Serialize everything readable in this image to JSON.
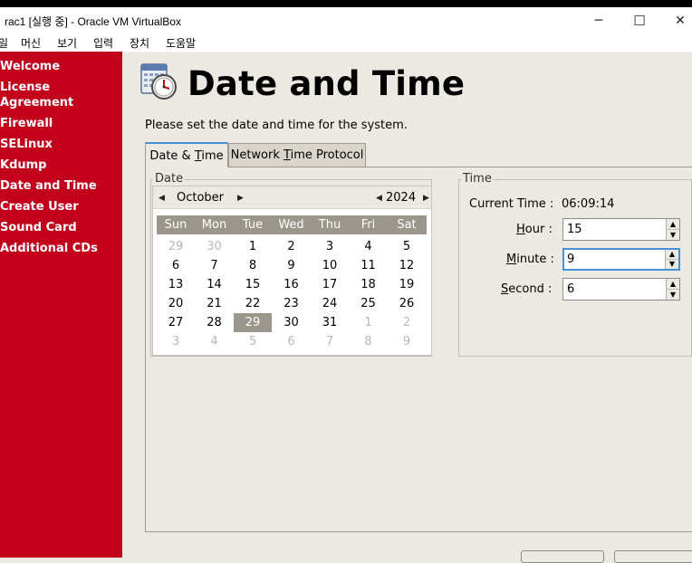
{
  "window": {
    "title": "rac1 [실행 중] - Oracle VM VirtualBox",
    "controls": {
      "minimize": "─",
      "maximize": "☐",
      "close": "✕"
    }
  },
  "menu": [
    "일",
    "머신",
    "보기",
    "입력",
    "장치",
    "도움말"
  ],
  "sidebar": {
    "steps": [
      "Welcome",
      "License Agreement",
      "Firewall",
      "SELinux",
      "Kdump",
      "Date and Time",
      "Create User",
      "Sound Card",
      "Additional CDs"
    ]
  },
  "page": {
    "title": "Date and Time",
    "subtitle": "Please set the date and time for the system."
  },
  "tabs": [
    {
      "pre": "Date & ",
      "u": "T",
      "post": "ime",
      "active": true
    },
    {
      "pre": "Network ",
      "u": "T",
      "post": "ime Protocol",
      "active": false
    }
  ],
  "date_frame": {
    "label": "Date",
    "month": "October",
    "year": "2024",
    "weekdays": [
      "Sun",
      "Mon",
      "Tue",
      "Wed",
      "Thu",
      "Fri",
      "Sat"
    ],
    "weeks": [
      [
        "29",
        "30",
        "1",
        "2",
        "3",
        "4",
        "5"
      ],
      [
        "6",
        "7",
        "8",
        "9",
        "10",
        "11",
        "12"
      ],
      [
        "13",
        "14",
        "15",
        "16",
        "17",
        "18",
        "19"
      ],
      [
        "20",
        "21",
        "22",
        "23",
        "24",
        "25",
        "26"
      ],
      [
        "27",
        "28",
        "29",
        "30",
        "31",
        "1",
        "2"
      ],
      [
        "3",
        "4",
        "5",
        "6",
        "7",
        "8",
        "9"
      ]
    ],
    "selected_day": "29"
  },
  "time_frame": {
    "label": "Time",
    "current_time_label": "Current Time :",
    "current_time": "06:09:14",
    "hour_label": {
      "u": "H",
      "post": "our :"
    },
    "minute_label": {
      "u": "M",
      "post": "inute :"
    },
    "second_label": {
      "u": "S",
      "post": "econd :"
    },
    "hour": "15",
    "minute": "9",
    "second": "6"
  },
  "colors": {
    "sidebar": "#c2001b",
    "background": "#ece9e2",
    "accent": "#4a90d9",
    "selected": "#9b968c"
  }
}
